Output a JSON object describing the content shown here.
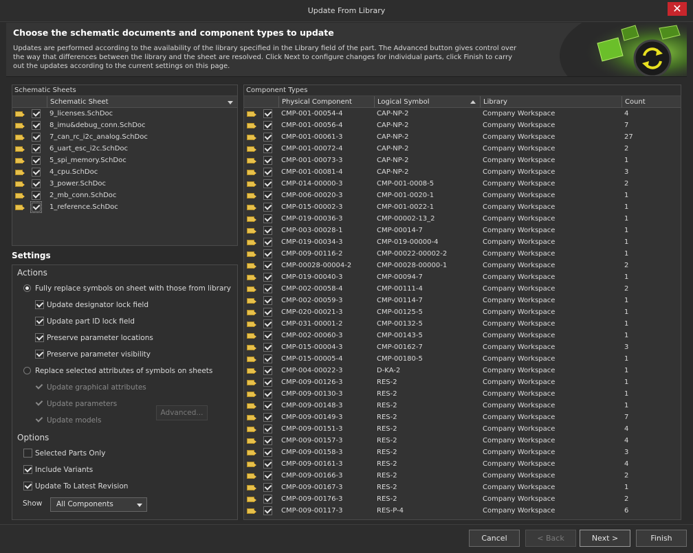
{
  "window": {
    "title": "Update From Library",
    "close_glyph": "✕"
  },
  "header": {
    "heading": "Choose the schematic documents and component types to update",
    "description": "Updates are performed according to the availability of the library specified in the Library field of the part. The Advanced button gives control over the way that differences between the library and the sheet are resolved. Click Next to configure changes for individual parts, click Finish to carry out the updates according to the current settings on this page."
  },
  "sheets_panel": {
    "title": "Schematic Sheets",
    "column": "Schematic Sheet",
    "rows": [
      {
        "name": "9_licenses.SchDoc",
        "checked": true
      },
      {
        "name": "8_imu&debug_conn.SchDoc",
        "checked": true
      },
      {
        "name": "7_can_rc_i2c_analog.SchDoc",
        "checked": true
      },
      {
        "name": "6_uart_esc_i2c.SchDoc",
        "checked": true
      },
      {
        "name": "5_spi_memory.SchDoc",
        "checked": true
      },
      {
        "name": "4_cpu.SchDoc",
        "checked": true
      },
      {
        "name": "3_power.SchDoc",
        "checked": true
      },
      {
        "name": "2_mb_conn.SchDoc",
        "checked": true
      },
      {
        "name": "1_reference.SchDoc",
        "checked": true
      }
    ]
  },
  "settings": {
    "title": "Settings",
    "actions_label": "Actions",
    "fully_replace": "Fully replace symbols on sheet with those from library",
    "update_designator_lock": "Update designator lock field",
    "update_part_id_lock": "Update part ID lock field",
    "preserve_param_locations": "Preserve parameter locations",
    "preserve_param_visibility": "Preserve parameter visibility",
    "replace_selected": "Replace selected attributes of symbols on sheets",
    "update_graphical": "Update graphical attributes",
    "update_parameters": "Update parameters",
    "update_models": "Update models",
    "advanced_button": "Advanced...",
    "options_label": "Options",
    "selected_parts_only": "Selected Parts Only",
    "include_variants": "Include Variants",
    "update_latest_revision": "Update To Latest Revision",
    "show_label": "Show",
    "show_value": "All Components"
  },
  "components_panel": {
    "title": "Component Types",
    "columns": {
      "physical": "Physical Component",
      "logical": "Logical Symbol",
      "library": "Library",
      "count": "Count"
    },
    "rows": [
      {
        "physical": "CMP-001-00054-4",
        "logical": "CAP-NP-2",
        "library": "Company Workspace",
        "count": "4"
      },
      {
        "physical": "CMP-001-00056-4",
        "logical": "CAP-NP-2",
        "library": "Company Workspace",
        "count": "7"
      },
      {
        "physical": "CMP-001-00061-3",
        "logical": "CAP-NP-2",
        "library": "Company Workspace",
        "count": "27"
      },
      {
        "physical": "CMP-001-00072-4",
        "logical": "CAP-NP-2",
        "library": "Company Workspace",
        "count": "2"
      },
      {
        "physical": "CMP-001-00073-3",
        "logical": "CAP-NP-2",
        "library": "Company Workspace",
        "count": "1"
      },
      {
        "physical": "CMP-001-00081-4",
        "logical": "CAP-NP-2",
        "library": "Company Workspace",
        "count": "3"
      },
      {
        "physical": "CMP-014-00000-3",
        "logical": "CMP-001-0008-5",
        "library": "Company Workspace",
        "count": "2"
      },
      {
        "physical": "CMP-006-00020-3",
        "logical": "CMP-001-0020-1",
        "library": "Company Workspace",
        "count": "1"
      },
      {
        "physical": "CMP-015-00002-3",
        "logical": "CMP-001-0022-1",
        "library": "Company Workspace",
        "count": "1"
      },
      {
        "physical": "CMP-019-00036-3",
        "logical": "CMP-00002-13_2",
        "library": "Company Workspace",
        "count": "1"
      },
      {
        "physical": "CMP-003-00028-1",
        "logical": "CMP-00014-7",
        "library": "Company Workspace",
        "count": "1"
      },
      {
        "physical": "CMP-019-00034-3",
        "logical": "CMP-019-00000-4",
        "library": "Company Workspace",
        "count": "1"
      },
      {
        "physical": "CMP-009-00116-2",
        "logical": "CMP-00022-00002-2",
        "library": "Company Workspace",
        "count": "1"
      },
      {
        "physical": "CMP-00028-00004-2",
        "logical": "CMP-00028-00000-1",
        "library": "Company Workspace",
        "count": "2"
      },
      {
        "physical": "CMP-019-00040-3",
        "logical": "CMP-00094-7",
        "library": "Company Workspace",
        "count": "1"
      },
      {
        "physical": "CMP-002-00058-4",
        "logical": "CMP-00111-4",
        "library": "Company Workspace",
        "count": "2"
      },
      {
        "physical": "CMP-002-00059-3",
        "logical": "CMP-00114-7",
        "library": "Company Workspace",
        "count": "1"
      },
      {
        "physical": "CMP-020-00021-3",
        "logical": "CMP-00125-5",
        "library": "Company Workspace",
        "count": "1"
      },
      {
        "physical": "CMP-031-00001-2",
        "logical": "CMP-00132-5",
        "library": "Company Workspace",
        "count": "1"
      },
      {
        "physical": "CMP-002-00060-3",
        "logical": "CMP-00143-5",
        "library": "Company Workspace",
        "count": "1"
      },
      {
        "physical": "CMP-015-00004-3",
        "logical": "CMP-00162-7",
        "library": "Company Workspace",
        "count": "3"
      },
      {
        "physical": "CMP-015-00005-4",
        "logical": "CMP-00180-5",
        "library": "Company Workspace",
        "count": "1"
      },
      {
        "physical": "CMP-004-00022-3",
        "logical": "D-KA-2",
        "library": "Company Workspace",
        "count": "1"
      },
      {
        "physical": "CMP-009-00126-3",
        "logical": "RES-2",
        "library": "Company Workspace",
        "count": "1"
      },
      {
        "physical": "CMP-009-00130-3",
        "logical": "RES-2",
        "library": "Company Workspace",
        "count": "1"
      },
      {
        "physical": "CMP-009-00148-3",
        "logical": "RES-2",
        "library": "Company Workspace",
        "count": "1"
      },
      {
        "physical": "CMP-009-00149-3",
        "logical": "RES-2",
        "library": "Company Workspace",
        "count": "7"
      },
      {
        "physical": "CMP-009-00151-3",
        "logical": "RES-2",
        "library": "Company Workspace",
        "count": "4"
      },
      {
        "physical": "CMP-009-00157-3",
        "logical": "RES-2",
        "library": "Company Workspace",
        "count": "4"
      },
      {
        "physical": "CMP-009-00158-3",
        "logical": "RES-2",
        "library": "Company Workspace",
        "count": "3"
      },
      {
        "physical": "CMP-009-00161-3",
        "logical": "RES-2",
        "library": "Company Workspace",
        "count": "4"
      },
      {
        "physical": "CMP-009-00166-3",
        "logical": "RES-2",
        "library": "Company Workspace",
        "count": "2"
      },
      {
        "physical": "CMP-009-00167-3",
        "logical": "RES-2",
        "library": "Company Workspace",
        "count": "1"
      },
      {
        "physical": "CMP-009-00176-3",
        "logical": "RES-2",
        "library": "Company Workspace",
        "count": "2"
      },
      {
        "physical": "CMP-009-00117-3",
        "logical": "RES-P-4",
        "library": "Company Workspace",
        "count": "6"
      }
    ]
  },
  "buttons": {
    "cancel": "Cancel",
    "back": "< Back",
    "next": "Next >",
    "finish": "Finish"
  }
}
